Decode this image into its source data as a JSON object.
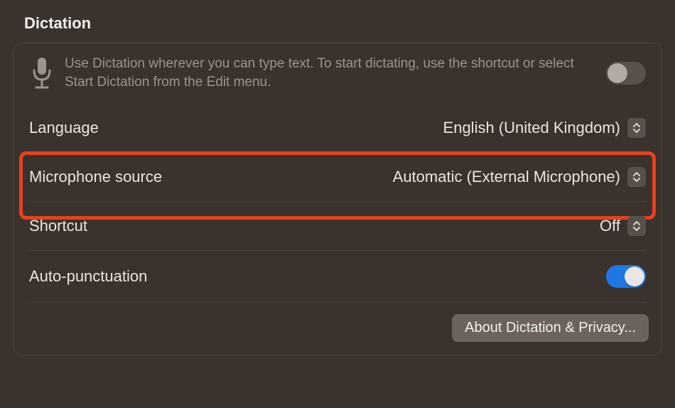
{
  "section": {
    "title": "Dictation"
  },
  "header": {
    "description": "Use Dictation wherever you can type text. To start dictating, use the shortcut or select Start Dictation from the Edit menu.",
    "toggleOn": false
  },
  "rows": {
    "language": {
      "label": "Language",
      "value": "English (United Kingdom)",
      "highlighted": true
    },
    "microphone": {
      "label": "Microphone source",
      "value": "Automatic (External Microphone)"
    },
    "shortcut": {
      "label": "Shortcut",
      "value": "Off"
    },
    "autopunct": {
      "label": "Auto-punctuation",
      "toggleOn": true
    }
  },
  "footer": {
    "aboutButton": "About Dictation & Privacy..."
  }
}
